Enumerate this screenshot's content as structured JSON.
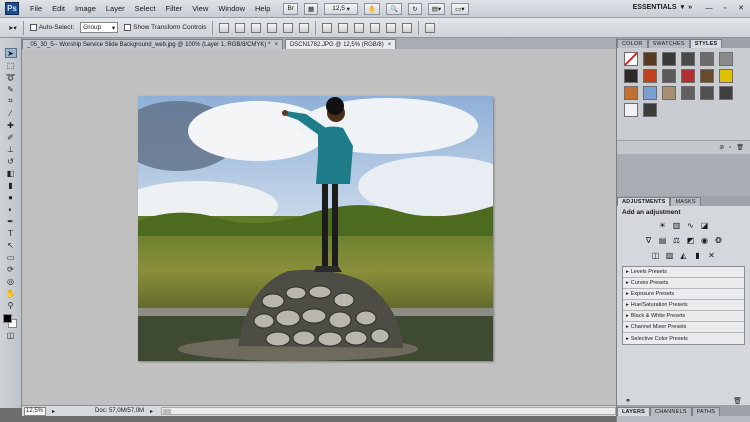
{
  "menubar": {
    "app_logo": "Ps",
    "items": [
      "File",
      "Edit",
      "Image",
      "Layer",
      "Select",
      "Filter",
      "View",
      "Window",
      "Help"
    ],
    "zoom": "12,5",
    "workspace": "ESSENTIALS"
  },
  "optbar": {
    "auto_select_label": "Auto-Select:",
    "auto_select_value": "Group",
    "transform_label": "Show Transform Controls"
  },
  "tabs": [
    {
      "label": "_05_30_5-- Worship Service Slide Background_web.jpg @ 100% (Layer 1, RGB/8/CMYK) *",
      "close": "×"
    },
    {
      "label": "DSCN1782.JPG @ 12,5% (RGB/8)",
      "close": "×"
    }
  ],
  "statusbar": {
    "zoom": "12,5%",
    "doc": "Doc: 57,0M/57,0M"
  },
  "panels": {
    "top_tabs": [
      "COLOR",
      "SWATCHES",
      "STYLES"
    ],
    "adjust_tabs": [
      "ADJUSTMENTS",
      "MASKS"
    ],
    "add_adjustment": "Add an adjustment",
    "presets": [
      "Levels Presets",
      "Curves Presets",
      "Exposure Presets",
      "Hue/Saturation Presets",
      "Black & White Presets",
      "Channel Mixer Presets",
      "Selective Color Presets"
    ],
    "bottom_tabs": [
      "LAYERS",
      "CHANNELS",
      "PATHS"
    ]
  },
  "styles_colors": [
    "#ffffff",
    "#5a3a22",
    "#3a3a3a",
    "#4a4a4a",
    "#6a6a6a",
    "#8a8a8a",
    "#2a2a2a",
    "#c04020",
    "#5a5a5a",
    "#b03030",
    "#6a4a2a",
    "#e0c000",
    "#c07030",
    "#7aa0d0",
    "#a89070",
    "#606060",
    "#505050",
    "#404040",
    "#f2f2f2",
    "#3c3c3c"
  ]
}
